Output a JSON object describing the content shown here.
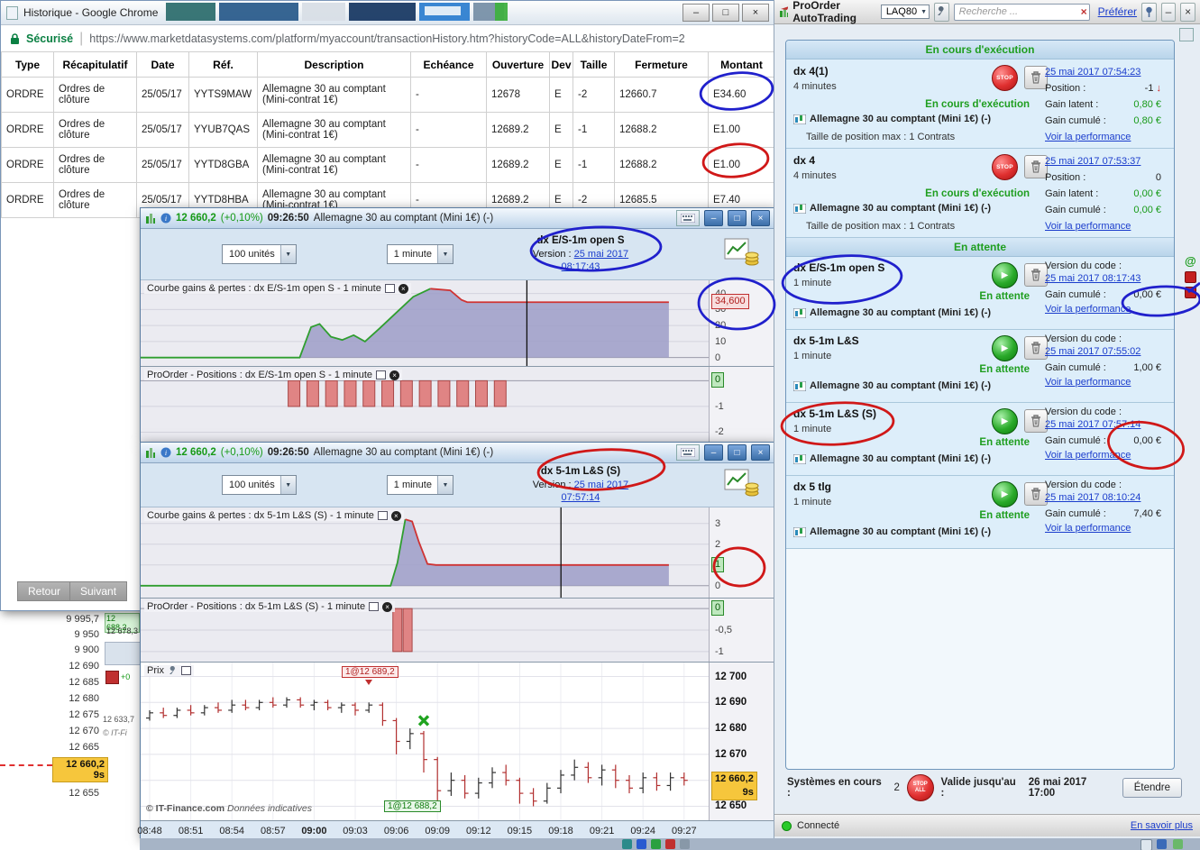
{
  "browser": {
    "title": "Historique - Google Chrome",
    "security": "Sécurisé",
    "url": "https://www.marketdatasystems.com/platform/myaccount/transactionHistory.htm?historyCode=ALL&historyDateFrom=2",
    "back_button": "Retour",
    "next_button": "Suivant",
    "table": {
      "headers": [
        "Type",
        "Récapitulatif",
        "Date",
        "Réf.",
        "Description",
        "Echéance",
        "Ouverture",
        "Dev",
        "Taille",
        "Fermeture",
        "Montant"
      ],
      "rows": [
        [
          "ORDRE",
          "Ordres de clôture",
          "25/05/17",
          "YYTS9MAW",
          "Allemagne 30 au comptant (Mini-contrat 1€)",
          "-",
          "12678",
          "E",
          "-2",
          "12660.7",
          "E34.60"
        ],
        [
          "ORDRE",
          "Ordres de clôture",
          "25/05/17",
          "YYUB7QAS",
          "Allemagne 30 au comptant (Mini-contrat 1€)",
          "-",
          "12689.2",
          "E",
          "-1",
          "12688.2",
          "E1.00"
        ],
        [
          "ORDRE",
          "Ordres de clôture",
          "25/05/17",
          "YYTD8GBA",
          "Allemagne 30 au comptant (Mini-contrat 1€)",
          "-",
          "12689.2",
          "E",
          "-1",
          "12688.2",
          "E1.00"
        ],
        [
          "ORDRE",
          "Ordres de clôture",
          "25/05/17",
          "YYTD8HBA",
          "Allemagne 30 au comptant (Mini-contrat 1€)",
          "-",
          "12689.2",
          "E",
          "-2",
          "12685.5",
          "E7.40"
        ]
      ]
    }
  },
  "chart_window_1": {
    "price": "12 660,2",
    "change": "(+0,10%)",
    "time": "09:26:50",
    "instrument": "Allemagne 30 au comptant (Mini 1€) (-)",
    "units_dropdown": "100 unités",
    "timeframe_dropdown": "1 minute",
    "system_name": "dx E/S-1m open S",
    "version_label": "Version :",
    "version_date": "25 mai 2017 08:17:43"
  },
  "chart_window_2": {
    "price": "12 660,2",
    "change": "(+0,10%)",
    "time": "09:26:50",
    "instrument": "Allemagne 30 au comptant (Mini 1€) (-)",
    "units_dropdown": "100 unités",
    "timeframe_dropdown": "1 minute",
    "system_name": "dx 5-1m L&S (S)",
    "version_label": "Version :",
    "version_date": "25 mai 2017 07:57:14"
  },
  "panel": {
    "title": "ProOrder AutoTrading",
    "account": "LAQ80",
    "search_placeholder": "Recherche ...",
    "prefer_link": "Préférer",
    "section_running": "En cours d'exécution",
    "section_waiting": "En attente",
    "instrument": "Allemagne 30 au comptant (Mini 1€) (-)",
    "labels": {
      "position": "Position :",
      "gain_latent": "Gain latent :",
      "gain_cumule": "Gain cumulé :",
      "version": "Version du code :",
      "taille": "Taille de position max : 1 Contrats",
      "perf": "Voir la performance",
      "status_running": "En cours d'exécution",
      "status_waiting": "En attente"
    },
    "running": [
      {
        "name": "dx 4(1)",
        "duration": "4 minutes",
        "date": "25 mai 2017 07:54:23",
        "position": "-1",
        "gain_latent": "0,80 €",
        "gain_cumule": "0,80 €"
      },
      {
        "name": "dx 4",
        "duration": "4 minutes",
        "date": "25 mai 2017 07:53:37",
        "position": "0",
        "gain_latent": "0,00 €",
        "gain_cumule": "0,00 €"
      }
    ],
    "waiting": [
      {
        "name": "dx E/S-1m open S",
        "duration": "1 minute",
        "date": "25 mai 2017 08:17:43",
        "gain_cumule": "0,00 €"
      },
      {
        "name": "dx 5-1m L&S",
        "duration": "1 minute",
        "date": "25 mai 2017 07:55:02",
        "gain_cumule": "1,00 €"
      },
      {
        "name": "dx 5-1m L&S (S)",
        "duration": "1 minute",
        "date": "25 mai 2017 07:57:14",
        "gain_cumule": "0,00 €"
      },
      {
        "name": "dx 5 tlg",
        "duration": "1 minute",
        "date": "25 mai 2017 08:10:24",
        "gain_cumule": "7,40 €"
      }
    ],
    "footer": {
      "systems_label": "Systèmes en cours :",
      "systems_count": "2",
      "valid_label": "Valide jusqu'au :",
      "valid_value": "26 mai 2017 17:00",
      "extend_button": "Étendre"
    },
    "status": {
      "connected": "Connecté",
      "more_link": "En savoir plus"
    }
  },
  "background": {
    "left_axis": [
      "9 995,7",
      "9 950",
      "9 900",
      "12 690",
      "12 685",
      "12 680",
      "12 675",
      "12 670",
      "12 665"
    ],
    "left_current": "12 660,2",
    "left_current_sub": "9s",
    "left_below": "12 655",
    "frag_price_a": "12 688,2",
    "frag_price_b": "12 678,3",
    "frag_plus": "+0",
    "frag_price_c": "12 633,7",
    "frag_copy": "© IT-Fi"
  },
  "annotation_colors": {
    "blue": "#2020cc",
    "red": "#d01818"
  },
  "chart_data": [
    {
      "id": "gains-es1m",
      "type": "area",
      "title": "Courbe gains & pertes : dx E/S-1m open S - 1 minute",
      "ylim": [
        -3,
        46
      ],
      "yticks": [
        "40",
        "30",
        "20",
        "10",
        "0"
      ],
      "ytick_vals": [
        40,
        30,
        20,
        10,
        0
      ],
      "points": [
        [
          0,
          0
        ],
        [
          0.28,
          0
        ],
        [
          0.3,
          19
        ],
        [
          0.315,
          21
        ],
        [
          0.335,
          13
        ],
        [
          0.355,
          11
        ],
        [
          0.375,
          14
        ],
        [
          0.395,
          10
        ],
        [
          0.42,
          18
        ],
        [
          0.45,
          28
        ],
        [
          0.48,
          38
        ],
        [
          0.51,
          43
        ],
        [
          0.545,
          42
        ],
        [
          0.565,
          36
        ],
        [
          0.575,
          34.6
        ],
        [
          0.93,
          34.6
        ]
      ],
      "split_frac": 0.51,
      "cursor_frac": 0.68,
      "current_val": 34.6,
      "current_label": "34,600",
      "current_color": "red"
    },
    {
      "id": "pos-es1m",
      "type": "bar",
      "title": "ProOrder - Positions : dx E/S-1m open S - 1 minute",
      "ylim": [
        -2.3,
        0.4
      ],
      "yticks": [
        "0",
        "-1",
        "-2"
      ],
      "ytick_vals": [
        0,
        -1,
        -2
      ],
      "bars_frac": [
        0.27,
        0.303,
        0.336,
        0.369,
        0.402,
        0.435,
        0.468,
        0.501,
        0.534,
        0.567,
        0.6,
        0.633
      ],
      "bar_value": -1,
      "current_val": 0,
      "current_label": "0",
      "current_color": "green"
    },
    {
      "id": "gains-51m",
      "type": "area",
      "title": "Courbe gains & pertes : dx 5-1m L&S (S) - 1 minute",
      "ylim": [
        -0.4,
        3.6
      ],
      "yticks": [
        "3",
        "2",
        "1",
        "0"
      ],
      "ytick_vals": [
        3,
        2,
        1,
        0
      ],
      "points": [
        [
          0,
          0
        ],
        [
          0.44,
          0
        ],
        [
          0.452,
          1.1
        ],
        [
          0.466,
          3.2
        ],
        [
          0.478,
          3.1
        ],
        [
          0.49,
          2.1
        ],
        [
          0.505,
          1.05
        ],
        [
          0.52,
          1.0
        ],
        [
          0.93,
          1.0
        ]
      ],
      "split_frac": 0.466,
      "cursor_frac": 0.74,
      "current_val": 1,
      "current_label": "1",
      "current_color": "green"
    },
    {
      "id": "pos-51m",
      "type": "bar",
      "title": "ProOrder - Positions : dx 5-1m L&S (S) - 1 minute",
      "ylim": [
        -1.15,
        0.15
      ],
      "yticks": [
        "0",
        "-0,5",
        "-1"
      ],
      "ytick_vals": [
        0,
        -0.5,
        -1
      ],
      "bars_frac": [
        0.452,
        0.47
      ],
      "bar_value": -1,
      "current_val": 0,
      "current_label": "0",
      "current_color": "green"
    },
    {
      "id": "price",
      "type": "candlestick",
      "title": "Prix",
      "ylim": [
        12646,
        12704
      ],
      "yticks": [
        "12 700",
        "12 690",
        "12 680",
        "12 670",
        "12 650"
      ],
      "ytick_vals": [
        12700,
        12690,
        12680,
        12670,
        12650
      ],
      "grid_vals": [
        12700,
        12690,
        12680,
        12670,
        12660,
        12650
      ],
      "current_val": 12660.2,
      "current_label": "12 660,2",
      "current_sub": "9s",
      "current_color": "yellow",
      "xticks": [
        "08:48",
        "08:51",
        "08:54",
        "08:57",
        "09:00",
        "09:03",
        "09:06",
        "09:09",
        "09:12",
        "09:15",
        "09:18",
        "09:21",
        "09:24",
        "09:27"
      ],
      "xbold": "09:00",
      "candles": [
        [
          12684,
          12687,
          12683,
          12686
        ],
        [
          12686,
          12688,
          12684,
          12685
        ],
        [
          12685,
          12688,
          12684,
          12687
        ],
        [
          12687,
          12689,
          12685,
          12686
        ],
        [
          12686,
          12689,
          12685,
          12688
        ],
        [
          12688,
          12690,
          12686,
          12687
        ],
        [
          12687,
          12691,
          12686,
          12689
        ],
        [
          12689,
          12691,
          12687,
          12688
        ],
        [
          12688,
          12691,
          12687,
          12690
        ],
        [
          12690,
          12692,
          12688,
          12689
        ],
        [
          12689,
          12692,
          12688,
          12691
        ],
        [
          12691,
          12692,
          12688,
          12689
        ],
        [
          12689,
          12691,
          12687,
          12690
        ],
        [
          12690,
          12691,
          12687,
          12688
        ],
        [
          12688,
          12690,
          12686,
          12689
        ],
        [
          12689,
          12690,
          12685,
          12687
        ],
        [
          12687,
          12690,
          12686,
          12689
        ],
        [
          12689,
          12690,
          12681,
          12683
        ],
        [
          12683,
          12684,
          12670,
          12675
        ],
        [
          12675,
          12680,
          12672,
          12678
        ],
        [
          12678,
          12679,
          12663,
          12668
        ],
        [
          12668,
          12669,
          12652,
          12656
        ],
        [
          12656,
          12663,
          12654,
          12660
        ],
        [
          12660,
          12662,
          12653,
          12655
        ],
        [
          12655,
          12661,
          12653,
          12659
        ],
        [
          12659,
          12665,
          12657,
          12663
        ],
        [
          12663,
          12666,
          12658,
          12660
        ],
        [
          12660,
          12661,
          12651,
          12655
        ],
        [
          12655,
          12657,
          12650,
          12652
        ],
        [
          12652,
          12659,
          12651,
          12657
        ],
        [
          12657,
          12664,
          12655,
          12662
        ],
        [
          12662,
          12668,
          12660,
          12665
        ],
        [
          12665,
          12667,
          12659,
          12661
        ],
        [
          12661,
          12666,
          12658,
          12664
        ],
        [
          12664,
          12666,
          12657,
          12660
        ],
        [
          12660,
          12662,
          12655,
          12657
        ],
        [
          12657,
          12663,
          12655,
          12661
        ],
        [
          12661,
          12663,
          12656,
          12658
        ],
        [
          12658,
          12663,
          12656,
          12661
        ],
        [
          12661,
          12663,
          12658,
          12660
        ]
      ],
      "sell_marker": {
        "label": "1@12 689,2",
        "index": 16
      },
      "buy_marker": {
        "label": "1@12 688,2",
        "index": 19
      },
      "x_marker": {
        "index": 20,
        "price": 12683
      },
      "watermark": "© IT-Finance.com",
      "watermark2": "Données indicatives"
    }
  ]
}
